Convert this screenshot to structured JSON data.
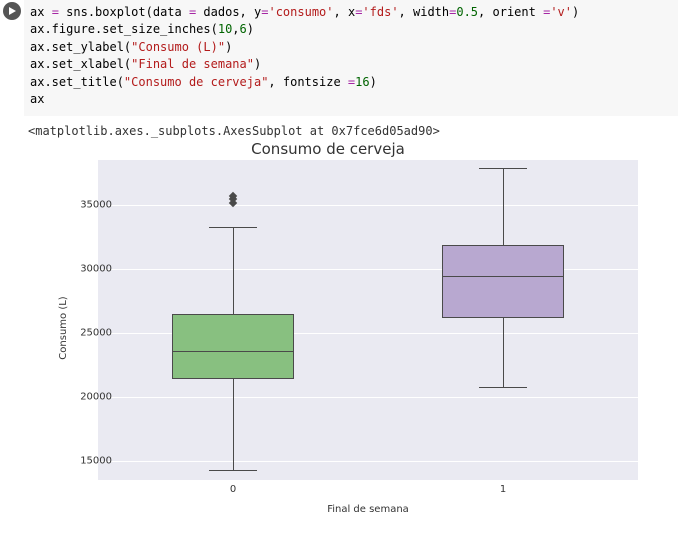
{
  "code": {
    "line1_pre": "ax ",
    "line1_op": "=",
    "line1_mid": " sns.boxplot(data ",
    "line1_op2": "=",
    "line1_mid2": " dados, y",
    "line1_op3": "=",
    "line1_str1": "'consumo'",
    "line1_mid3": ", x",
    "line1_op4": "=",
    "line1_str2": "'fds'",
    "line1_mid4": ", width",
    "line1_op5": "=",
    "line1_num1": "0.5",
    "line1_mid5": ", orient ",
    "line1_op6": "=",
    "line1_str3": "'v'",
    "line1_end": ")",
    "line2_pre": "ax.figure.set_size_inches(",
    "line2_num1": "10",
    "line2_mid": ",",
    "line2_num2": "6",
    "line2_end": ")",
    "line3_pre": "ax.set_ylabel(",
    "line3_str": "\"Consumo (L)\"",
    "line3_end": ")",
    "line4_pre": "ax.set_xlabel(",
    "line4_str": "\"Final de semana\"",
    "line4_end": ")",
    "line5_pre": "ax.set_title(",
    "line5_str": "\"Consumo de cerveja\"",
    "line5_mid": ", fontsize ",
    "line5_op": "=",
    "line5_num": "16",
    "line5_end": ")",
    "line6": "ax"
  },
  "output_repr": "<matplotlib.axes._subplots.AxesSubplot at 0x7fce6d05ad90>",
  "chart_data": {
    "type": "boxplot",
    "title": "Consumo de cerveja",
    "xlabel": "Final de semana",
    "ylabel": "Consumo (L)",
    "categories": [
      "0",
      "1"
    ],
    "yticks": [
      15000,
      20000,
      25000,
      30000,
      35000
    ],
    "ylim": [
      13500,
      38500
    ],
    "series": [
      {
        "name": "0",
        "q1": 21400,
        "median": 23600,
        "q3": 26500,
        "whisker_low": 14300,
        "whisker_high": 33300,
        "outliers": [
          35200,
          35500,
          35700
        ],
        "color": "#88c080"
      },
      {
        "name": "1",
        "q1": 26200,
        "median": 29500,
        "q3": 31900,
        "whisker_low": 20800,
        "whisker_high": 37900,
        "outliers": [],
        "color": "#b8a8d0"
      }
    ]
  }
}
